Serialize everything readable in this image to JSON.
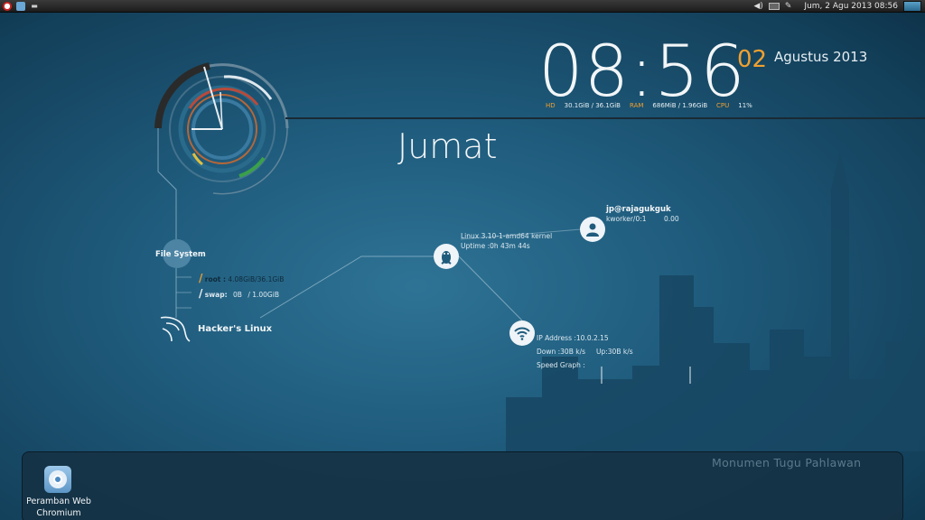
{
  "top_panel": {
    "clock": "Jum,  2 Agu 2013 08:56",
    "left_icons": [
      "app-menu-icon",
      "browser-icon",
      "terminal-icon"
    ],
    "right_icons": [
      "volume-icon",
      "keyboard-icon",
      "pen-icon",
      "workspace-thumbnail"
    ]
  },
  "clock": {
    "time": "08:56",
    "day": "02",
    "month_year": "Agustus 2013",
    "weekday": "Jumat"
  },
  "stats": {
    "hd_label": "HD",
    "hd_value": "30.1GiB / 36.1GiB",
    "ram_label": "RAM",
    "ram_value": "686MiB / 1.96GiB",
    "cpu_label": "CPU",
    "cpu_value": "11%"
  },
  "filesystem": {
    "title": "File System",
    "root_label": "root :",
    "root_value": "4.08GiB/36.1GiB",
    "swap_label": "swap:",
    "swap_used": "0B",
    "swap_total": "/ 1.00GiB",
    "slash": "/"
  },
  "hacker": {
    "label": "Hacker's Linux"
  },
  "kernel": {
    "line1": "Linux 3.10-1-amd64 kernel",
    "line2": "Uptime :0h 43m 44s"
  },
  "user": {
    "name": "jp@rajagukguk",
    "process": "kworker/0:1",
    "process_value": "0.00"
  },
  "network": {
    "ip": "IP Address :10.0.2.15",
    "down": "Down :30B   k/s",
    "up": "Up:30B    k/s",
    "graph": "Speed Graph :"
  },
  "dock": {
    "caption": "Monumen Tugu Pahlawan",
    "apps": [
      {
        "label_line1": "Peramban Web",
        "label_line2": "Chromium"
      }
    ]
  },
  "colors": {
    "accent": "#f0a030",
    "background": "#1f5b7c"
  }
}
